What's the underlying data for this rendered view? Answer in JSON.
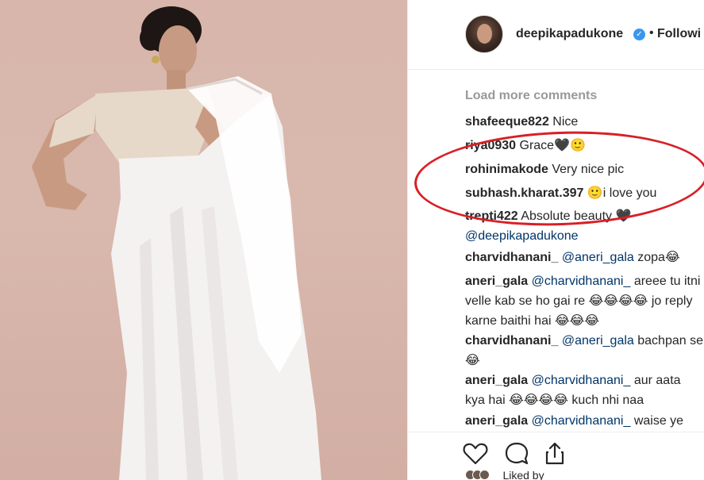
{
  "post": {
    "username": "deepikapadukone",
    "follow_label": "Followi",
    "dot": "•",
    "verified_glyph": "✓"
  },
  "comments": {
    "load_more": "Load more comments",
    "items": [
      {
        "user": "shafeeque822",
        "text": " Nice"
      },
      {
        "user": "riya0930",
        "text": " Grace🖤🙂"
      },
      {
        "user": "rohinimakode",
        "text": " Very nice pic"
      },
      {
        "user": "subhash.kharat.397",
        "text": " 🙂i love you"
      },
      {
        "user": "trepti422",
        "text": " Absolute beauty 🖤",
        "mention": "@deepikapadukone"
      },
      {
        "user": "charvidhanani_",
        "mention": " @aneri_gala",
        "text": " zopa😂"
      },
      {
        "user": "aneri_gala",
        "mention": " @charvidhanani_",
        "text": " areee tu itni velle kab se ho gai re 😂😂😂😂 jo reply karne baithi hai 😂😂😂"
      },
      {
        "user": "charvidhanani_",
        "mention": " @aneri_gala",
        "text": " bachpan se😂"
      },
      {
        "user": "aneri_gala",
        "mention": " @charvidhanani_",
        "text": " aur aata kya hai 😂😂😂😂 kuch nhi naa"
      },
      {
        "user": "aneri_gala",
        "mention": " @charvidhanani_",
        "text": " waise ye"
      }
    ]
  },
  "actions": {
    "like_icon": "heart-icon",
    "comment_icon": "comment-bubble-icon",
    "share_icon": "share-icon",
    "liked_by_text": "Liked by"
  },
  "colors": {
    "annotation": "#d81f26",
    "mention": "#003569",
    "muted": "#999999",
    "verified": "#3897f0"
  }
}
